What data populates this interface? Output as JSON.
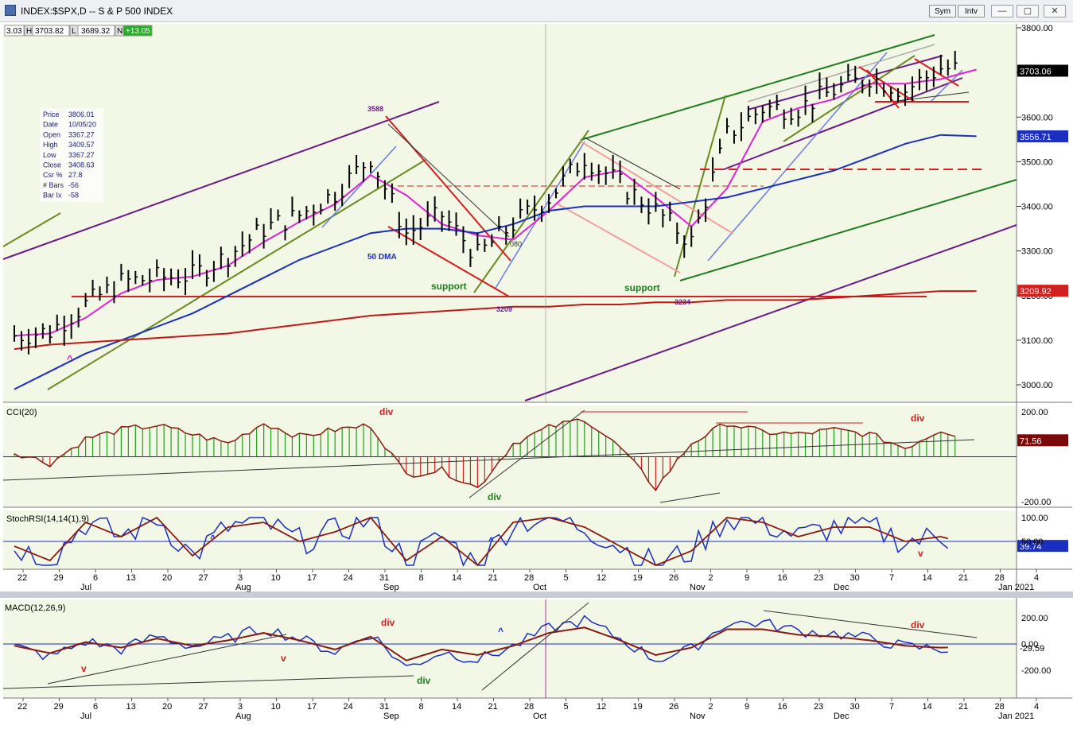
{
  "window": {
    "title": "INDEX:$SPX,D -- S & P 500 INDEX",
    "sym_label": "Sym",
    "intv_label": "Intv",
    "minimize": "—",
    "restore": "▢",
    "close": "✕"
  },
  "header": {
    "o_value": "3.03",
    "h_label": "H",
    "h_value": "3703.82",
    "l_label": "L",
    "l_value": "3689.32",
    "n_label": "N",
    "n_value": "+13.05"
  },
  "info_box": {
    "rows": [
      [
        "Price",
        "3806.01"
      ],
      [
        "Date",
        "10/05/20"
      ],
      [
        "Open",
        "3367.27"
      ],
      [
        "High",
        "3409.57"
      ],
      [
        "Low",
        "3367.27"
      ],
      [
        "Close",
        "3408.63"
      ],
      [
        "Csr %",
        "27.8"
      ],
      [
        "# Bars",
        "-56"
      ],
      [
        "Bar Ix",
        "-58"
      ]
    ]
  },
  "price_panel": {
    "y_ticks": [
      "3800.00",
      "3700.00",
      "3600.00",
      "3500.00",
      "3400.00",
      "3300.00",
      "3200.00",
      "3100.00",
      "3000.00"
    ],
    "last_price_label": "3703.06",
    "ma50_label": "3556.71",
    "ma200_label": "3209.92",
    "annotations": {
      "a3588": "3588",
      "a3209": "3209",
      "a3234": "3234",
      "a080": "080",
      "support1": "support",
      "support2": "support",
      "dma50": "50 DMA",
      "caret": "^"
    }
  },
  "cci_panel": {
    "title": "CCI(20)",
    "y_ticks": [
      "200.00",
      "-200.00"
    ],
    "value_label": "71.56",
    "annotations": {
      "div1": "div",
      "div2": "div",
      "div3": "div"
    }
  },
  "stoch_panel": {
    "title": "StochRSI(14,14(1),9)",
    "y_ticks": [
      "100.00",
      "50.00"
    ],
    "value_label": "39.74",
    "annotations": {
      "up1": "^",
      "up2": "^",
      "down1": "v"
    }
  },
  "macd_panel": {
    "title": "MACD(12,26,9)",
    "y_ticks": [
      "200.00",
      "0.00",
      "-200.00"
    ],
    "value_label": "-29.59",
    "annotations": {
      "div1": "div",
      "div2": "div",
      "div3": "div",
      "v1": "v",
      "v2": "v",
      "up1": "^"
    }
  },
  "x_axis": {
    "day_ticks": [
      "22",
      "29",
      "6",
      "13",
      "20",
      "27",
      "3",
      "10",
      "17",
      "24",
      "31",
      "8",
      "14",
      "21",
      "28",
      "5",
      "12",
      "19",
      "26",
      "2",
      "9",
      "16",
      "23",
      "30",
      "7",
      "14",
      "21",
      "28",
      "4"
    ],
    "months": [
      "Jul",
      "Aug",
      "Sep",
      "Oct",
      "Nov",
      "Dec",
      "Jan 2021"
    ]
  },
  "colors": {
    "background": "#f3f8e6",
    "green": "#1e7e1e",
    "red": "#d22020",
    "purple": "#6a1a8a",
    "blue": "#1a2ec0",
    "magenta": "#e020d8",
    "olive": "#6a8a20",
    "brown": "#7a1a10"
  },
  "chart_data": {
    "type": "line",
    "title": "INDEX:$SPX,D -- S & P 500 INDEX",
    "x": [
      "Jun 22",
      "Jun 29",
      "Jul 6",
      "Jul 13",
      "Jul 20",
      "Jul 27",
      "Aug 3",
      "Aug 10",
      "Aug 17",
      "Aug 24",
      "Aug 31",
      "Sep 8",
      "Sep 14",
      "Sep 21",
      "Sep 28",
      "Oct 5",
      "Oct 12",
      "Oct 19",
      "Oct 26",
      "Nov 2",
      "Nov 9",
      "Nov 16",
      "Nov 23",
      "Nov 30",
      "Dec 7",
      "Dec 14",
      "Dec 21",
      "Dec 28"
    ],
    "series": [
      {
        "name": "Close",
        "values": [
          3110,
          3120,
          3180,
          3230,
          3240,
          3245,
          3290,
          3350,
          3380,
          3430,
          3510,
          3340,
          3380,
          3290,
          3360,
          3420,
          3510,
          3450,
          3390,
          3320,
          3560,
          3620,
          3620,
          3660,
          3690,
          3660,
          3710,
          3703
        ]
      },
      {
        "name": "50 DMA",
        "values": [
          2990,
          3030,
          3070,
          3100,
          3130,
          3160,
          3200,
          3240,
          3280,
          3310,
          3340,
          3350,
          3350,
          3340,
          3360,
          3390,
          3400,
          3400,
          3400,
          3410,
          3420,
          3440,
          3460,
          3480,
          3510,
          3540,
          3560,
          3557
        ]
      },
      {
        "name": "200 DMA",
        "values": [
          3080,
          3090,
          3095,
          3100,
          3105,
          3110,
          3115,
          3125,
          3135,
          3145,
          3155,
          3160,
          3165,
          3170,
          3175,
          3175,
          3180,
          3180,
          3185,
          3185,
          3190,
          3190,
          3190,
          3195,
          3200,
          3205,
          3210,
          3210
        ]
      }
    ],
    "ylim": [
      2950,
      3830
    ],
    "annotations": [
      "3588",
      "3209",
      "3234",
      "support",
      "support",
      "50 DMA"
    ]
  }
}
